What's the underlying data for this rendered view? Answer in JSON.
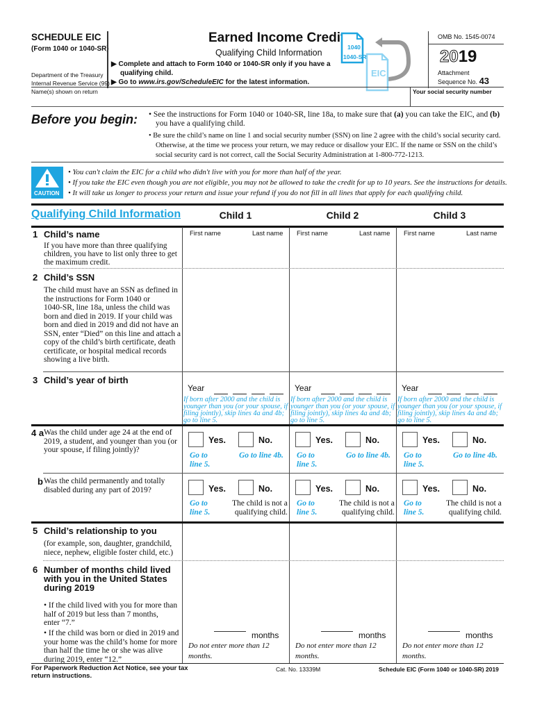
{
  "header": {
    "schedule": "SCHEDULE EIC",
    "form_ref": "(Form 1040 or 1040-SR)",
    "department": "Department of the Treasury",
    "irs": "Internal Revenue Service (99)",
    "title": "Earned Income Credit",
    "subtitle": "Qualifying Child Information",
    "instruction1": "Complete and attach to Form 1040 or 1040-SR only if you have a",
    "instruction1b": "qualifying child.",
    "instruction2_prefix": "Go to",
    "instruction2_link": "www.irs.gov/ScheduleEIC",
    "instruction2_suffix": "for the latest information.",
    "icon_label_top1": "1040",
    "icon_label_top2": "1040-SR",
    "icon_label_eic": "EIC",
    "omb": "OMB No. 1545-0074",
    "year_outline": "20",
    "year_bold": "19",
    "attachment": "Attachment",
    "sequence_label": "Sequence No.",
    "sequence_no": "43",
    "name_label": "Name(s) shown on return",
    "ssn_label": "Your social security number"
  },
  "before": {
    "heading": "Before you begin:",
    "bullet1_a": "• See the instructions for Form 1040 or 1040-SR, line 18a, to make sure that ",
    "bullet1_b": "(a)",
    "bullet1_c": " you can take the EIC, and ",
    "bullet1_d": "(b)",
    "bullet1_e": "you have a qualifying child.",
    "bullet2_l1": "• Be sure the child’s name on line 1 and social security number (SSN) on line 2 agree with the child’s social security card.",
    "bullet2_l2": "Otherwise, at the time we process your return, we may reduce or disallow your EIC. If the name or SSN on the child’s",
    "bullet2_l3": "social security card is not correct, call the Social Security Administration at 1-800-772-1213."
  },
  "caution": {
    "label": "CAUTION",
    "items": [
      "• You can't claim the EIC for a child who didn't live with you for more than half of the year.",
      "• If you take the EIC even though you are not eligible, you may not be allowed to take the credit for up to 10 years. See the instructions for details.",
      "• It will take us longer to process your return and issue your refund if you do not fill in all lines that apply for each qualifying child."
    ]
  },
  "section": {
    "title": "Qualifying Child Information",
    "columns": [
      "Child 1",
      "Child 2",
      "Child 3"
    ]
  },
  "lines": {
    "l1_num": "1",
    "l1_title": "Child’s name",
    "l1_text": [
      "If you have more than three qualifying",
      "children, you have to list only three to get",
      "the maximum credit."
    ],
    "first_name": "First name",
    "last_name": "Last name",
    "l2_num": "2",
    "l2_title": "Child’s SSN",
    "l2_text": [
      "The child must have an SSN as defined in",
      "the instructions for Form 1040 or",
      "1040-SR, line 18a, unless the child was",
      "born and died in 2019. If your child was",
      "born and died in 2019 and did not have an",
      "SSN, enter “Died” on this line and attach a",
      "copy of the child’s birth certificate, death",
      "certificate, or hospital medical records",
      "showing a live birth."
    ],
    "l3_num": "3",
    "l3_title": "Child’s year of birth",
    "year_label": "Year",
    "year_note": [
      "If born after 2000 and the child is",
      "younger than you (or your spouse, if",
      "filing jointly), skip lines 4a and 4b;",
      "go to line 5."
    ],
    "l4a_num": "4 a",
    "l4a_text": [
      "Was the child under age 24 at the end of",
      "2019, a student, and younger than you (or",
      "your spouse, if filing jointly)?"
    ],
    "l4b_num": "b",
    "l4b_text": [
      "Was the child permanently and totally",
      "disabled during any part of 2019?"
    ],
    "yes": "Yes.",
    "no": "No.",
    "goto_line5": [
      "Go to",
      "line 5."
    ],
    "goto_4b": "Go to line 4b.",
    "not_qualifying": [
      "The child is not a",
      "qualifying child."
    ],
    "l5_num": "5",
    "l5_title": "Child’s relationship to you",
    "l5_text": [
      "(for example, son, daughter, grandchild,",
      "niece, nephew, eligible foster child, etc.)"
    ],
    "l6_num": "6",
    "l6_title": [
      "Number of months child lived",
      "with you in the United States",
      "during 2019"
    ],
    "l6_bullet1": [
      "• If the child lived with you for more than",
      "half of 2019 but less than 7 months,",
      "enter “7.”"
    ],
    "l6_bullet2": [
      "• If the child was born or died in 2019 and",
      "your home was the child’s home for more",
      "than half the time he or she was alive",
      "during 2019, enter “12.”"
    ],
    "months": "months",
    "months_note": [
      "Do not enter more than 12",
      "months."
    ]
  },
  "footer": {
    "paperwork": [
      "For Paperwork Reduction Act Notice, see your tax",
      "return instructions."
    ],
    "cat": "Cat. No. 13339M",
    "form_id": "Schedule EIC (Form 1040 or 1040-SR) 2019"
  }
}
